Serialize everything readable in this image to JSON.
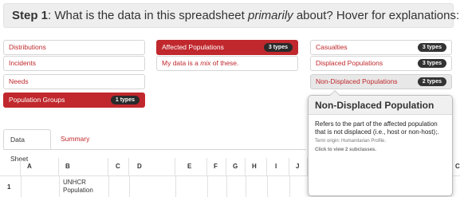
{
  "header": {
    "step": "Step 1",
    "text_a": ": What is the data in this spreadsheet ",
    "emphasis": "primarily",
    "text_b": " about? Hover for explanations:"
  },
  "categories": {
    "distributions": "Distributions",
    "incidents": "Incidents",
    "needs": "Needs",
    "population_groups": {
      "label": "Population Groups",
      "badge": "1 types"
    },
    "affected_populations": {
      "label": "Affected Populations",
      "badge": "3 types"
    },
    "mix": {
      "prefix": "My data is a ",
      "em": "mix",
      "suffix": " of these."
    },
    "casualties": {
      "label": "Casualties",
      "badge": "3 types"
    },
    "displaced_populations": {
      "label": "Displaced Populations",
      "badge": "3 types"
    },
    "non_displaced_populations": {
      "label": "Non-Displaced Populations",
      "badge": "2 types"
    }
  },
  "tooltip": {
    "title": "Non-Displaced Population",
    "body": "Refers to the part of the affected population that is not displaced (i.e., host or non-host);.",
    "origin": "Term origin: Humanitarian Profile.",
    "action": "Click to view 2 subclasses."
  },
  "tabs": [
    "Data Sheet",
    "Summary"
  ],
  "sheet": {
    "columns": [
      "A",
      "B",
      "C",
      "D",
      "E",
      "F",
      "G",
      "H",
      "I",
      "J",
      "C"
    ],
    "row_number": "1",
    "cell_b1": "UNHCR Population"
  }
}
